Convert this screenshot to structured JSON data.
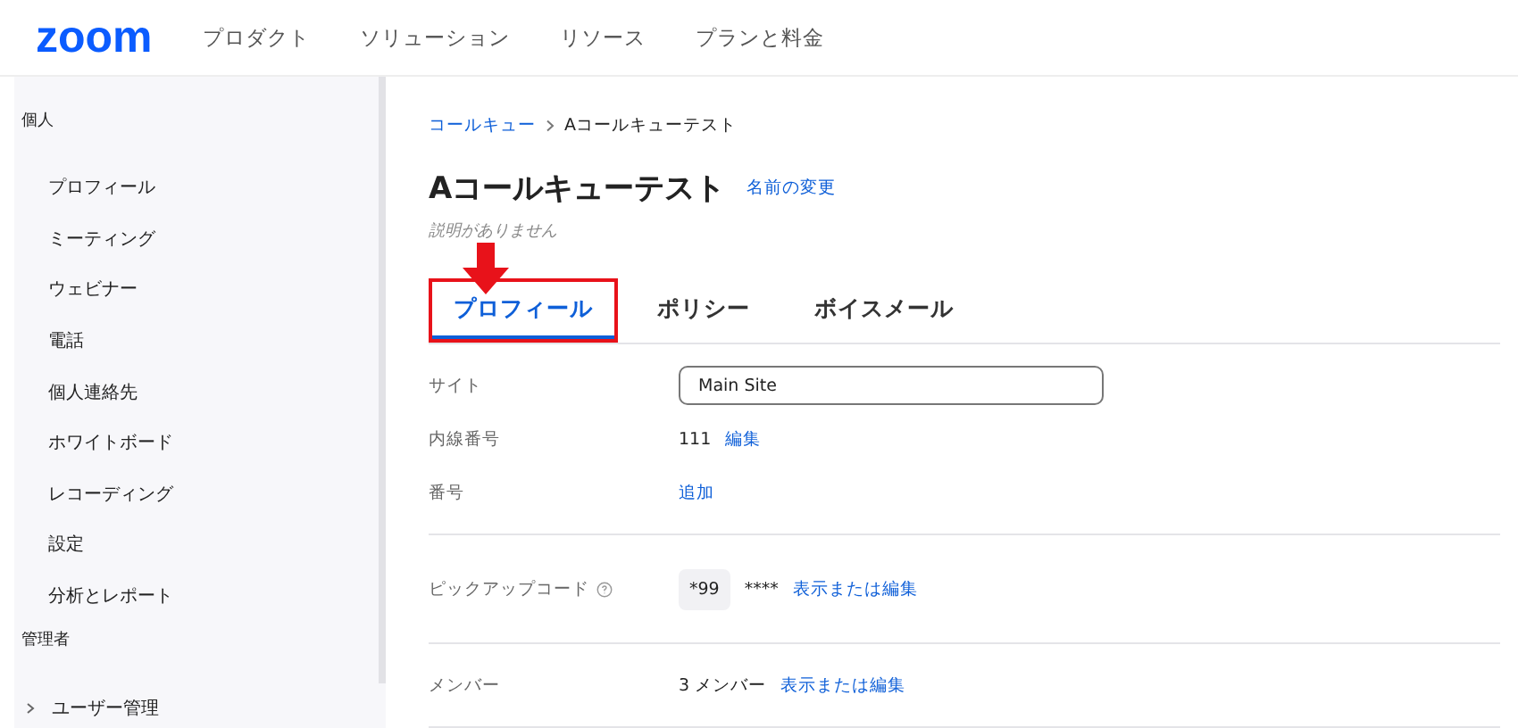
{
  "header": {
    "logo": "zoom",
    "nav": [
      "プロダクト",
      "ソリューション",
      "リソース",
      "プランと料金"
    ]
  },
  "sidebar": {
    "sections": [
      {
        "title": "個人",
        "items": [
          {
            "label": "プロフィール"
          },
          {
            "label": "ミーティング"
          },
          {
            "label": "ウェビナー"
          },
          {
            "label": "電話"
          },
          {
            "label": "個人連絡先"
          },
          {
            "label": "ホワイトボード"
          },
          {
            "label": "レコーディング"
          },
          {
            "label": "設定"
          },
          {
            "label": "分析とレポート"
          }
        ]
      },
      {
        "title": "管理者",
        "items": [
          {
            "label": "ユーザー管理",
            "expandable": true
          }
        ]
      }
    ]
  },
  "breadcrumb": [
    "コールキュー",
    "Aコールキューテスト"
  ],
  "title": "Aコールキューテスト",
  "rename_link": "名前の変更",
  "description": "説明がありません",
  "tabs": [
    {
      "label": "プロフィール",
      "selected": true,
      "highlighted": true
    },
    {
      "label": "ポリシー",
      "selected": false,
      "highlighted": false
    },
    {
      "label": "ボイスメール",
      "selected": false,
      "highlighted": false
    }
  ],
  "sections": [
    {
      "rows": [
        {
          "kind": "field",
          "label": "サイト",
          "value": "Main Site"
        },
        {
          "kind": "text",
          "label": "内線番号",
          "value": "111",
          "link": "編集"
        },
        {
          "kind": "text",
          "label": "番号",
          "link": "追加"
        }
      ]
    },
    {
      "rows": [
        {
          "kind": "code",
          "label": "ピックアップコード",
          "help": true,
          "code": "*99",
          "value": "****",
          "link": "表示または編集"
        }
      ]
    },
    {
      "rows": [
        {
          "kind": "text",
          "label": "メンバー",
          "value": "3 メンバー",
          "link": "表示または編集"
        }
      ]
    }
  ]
}
